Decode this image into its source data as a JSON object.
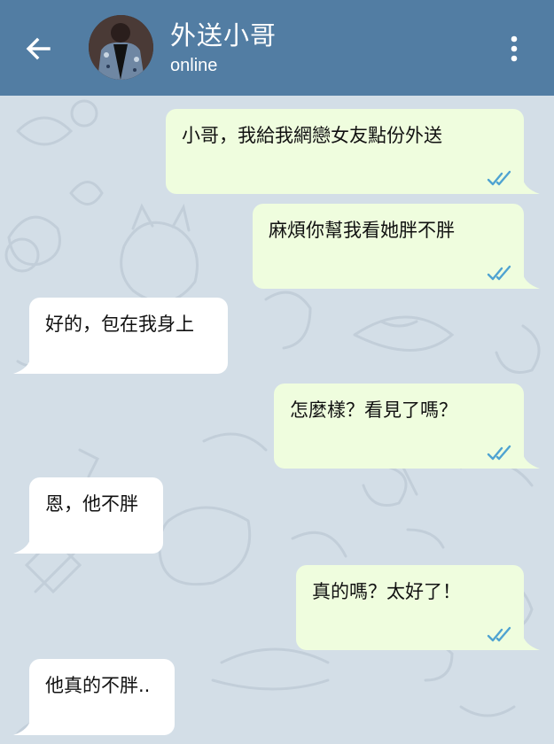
{
  "header": {
    "contact_name": "外送小哥",
    "status": "online",
    "back_icon": "arrow-left-icon",
    "menu_icon": "more-vertical-icon"
  },
  "colors": {
    "header_bg": "#527da3",
    "outgoing_bubble": "#effdde",
    "incoming_bubble": "#ffffff",
    "read_ticks": "#4fa3d1",
    "wallpaper": "#d3dee7"
  },
  "messages": [
    {
      "direction": "out",
      "text": "小哥，我給我網戀女友點份外送",
      "read": true
    },
    {
      "direction": "out",
      "text": "麻煩你幫我看她胖不胖",
      "read": true
    },
    {
      "direction": "in",
      "text": "好的，包在我身上"
    },
    {
      "direction": "out",
      "text": "怎麼樣？看見了嗎？",
      "read": true
    },
    {
      "direction": "in",
      "text": "恩，他不胖"
    },
    {
      "direction": "out",
      "text": "真的嗎？太好了！",
      "read": true
    },
    {
      "direction": "in",
      "text": "他真的不胖.."
    }
  ]
}
